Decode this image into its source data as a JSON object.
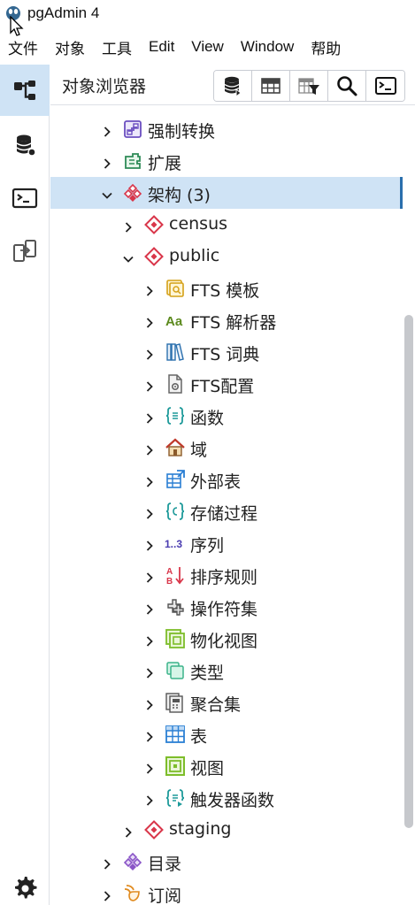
{
  "app": {
    "title": "pgAdmin 4"
  },
  "menu": [
    "文件",
    "对象",
    "工具",
    "Edit",
    "View",
    "Window",
    "帮助"
  ],
  "panel": {
    "title": "对象浏览器"
  },
  "toolbar": [
    "database-query-icon",
    "table-grid-icon",
    "table-filter-icon",
    "search-icon",
    "terminal-icon"
  ],
  "activity_bar": [
    "object-tree-icon",
    "database-icon",
    "terminal-icon",
    "schema-diff-icon",
    "settings-gear-icon"
  ],
  "colors": {
    "accent": "#2a6fad",
    "selection": "#cfe3f5",
    "schema_red": "#d9364a",
    "cast_purple": "#6b4fc0",
    "ext_green": "#2e8b57",
    "func_teal": "#1e9a9a",
    "fts_yellow": "#d4a017",
    "view_green": "#7dbd2a"
  },
  "tree": [
    {
      "label": "强制转换",
      "icon": "cast-icon",
      "expanded": false
    },
    {
      "label": "扩展",
      "icon": "extension-icon",
      "expanded": false
    },
    {
      "label": "架构 (3)",
      "icon": "schemas-icon",
      "expanded": true,
      "selected": true
    },
    {
      "label": "census",
      "icon": "schema-icon",
      "expanded": false
    },
    {
      "label": "public",
      "icon": "schema-icon",
      "expanded": true
    },
    {
      "label": "FTS 模板",
      "icon": "fts-template-icon",
      "expanded": false
    },
    {
      "label": "FTS 解析器",
      "icon": "fts-parser-icon",
      "expanded": false
    },
    {
      "label": "FTS 词典",
      "icon": "fts-dictionary-icon",
      "expanded": false
    },
    {
      "label": "FTS配置",
      "icon": "fts-configuration-icon",
      "expanded": false
    },
    {
      "label": "函数",
      "icon": "function-icon",
      "expanded": false
    },
    {
      "label": "域",
      "icon": "domain-icon",
      "expanded": false
    },
    {
      "label": "外部表",
      "icon": "foreign-table-icon",
      "expanded": false
    },
    {
      "label": "存储过程",
      "icon": "procedure-icon",
      "expanded": false
    },
    {
      "label": "序列",
      "icon": "sequence-icon",
      "expanded": false
    },
    {
      "label": "排序规则",
      "icon": "collation-icon",
      "expanded": false
    },
    {
      "label": "操作符集",
      "icon": "operator-icon",
      "expanded": false
    },
    {
      "label": "物化视图",
      "icon": "materialized-view-icon",
      "expanded": false
    },
    {
      "label": "类型",
      "icon": "type-icon",
      "expanded": false
    },
    {
      "label": "聚合集",
      "icon": "aggregate-icon",
      "expanded": false
    },
    {
      "label": "表",
      "icon": "table-icon",
      "expanded": false
    },
    {
      "label": "视图",
      "icon": "view-icon",
      "expanded": false
    },
    {
      "label": "触发器函数",
      "icon": "trigger-function-icon",
      "expanded": false
    },
    {
      "label": "staging",
      "icon": "schema-icon",
      "expanded": false
    },
    {
      "label": "目录",
      "icon": "catalog-icon",
      "expanded": false
    },
    {
      "label": "订阅",
      "icon": "subscription-icon",
      "expanded": false
    }
  ]
}
